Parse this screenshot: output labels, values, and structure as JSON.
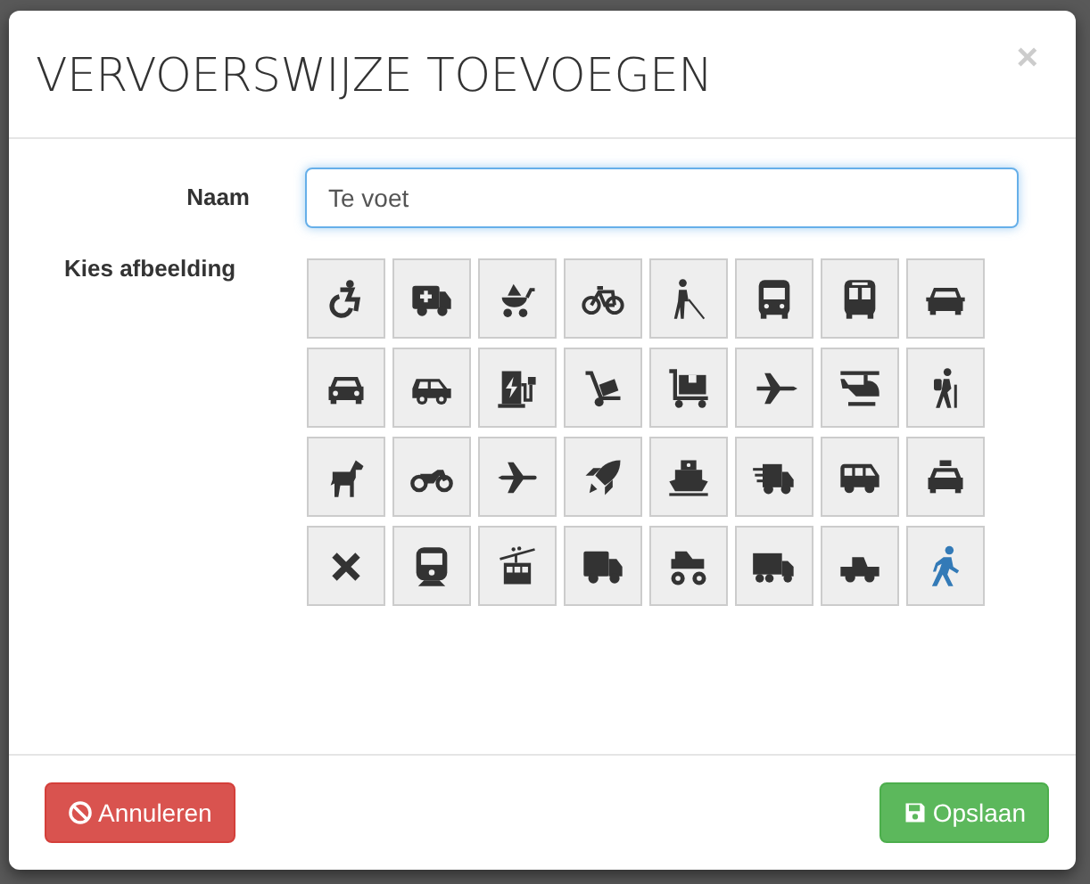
{
  "dialog": {
    "title": "VERVOERSWIJZE TOEVOEGEN",
    "close": "×"
  },
  "name_field": {
    "label": "Naam",
    "value": "Te voet"
  },
  "image_picker": {
    "label": "Kies afbeelding",
    "icons": [
      {
        "kind": "wheelchair",
        "selected": false
      },
      {
        "kind": "ambulance",
        "selected": false
      },
      {
        "kind": "stroller",
        "selected": false
      },
      {
        "kind": "bicycle",
        "selected": false
      },
      {
        "kind": "blind",
        "selected": false
      },
      {
        "kind": "bus",
        "selected": false
      },
      {
        "kind": "bus-alt",
        "selected": false
      },
      {
        "kind": "car-front",
        "selected": false
      },
      {
        "kind": "car-front-alt",
        "selected": false
      },
      {
        "kind": "car-side",
        "selected": false
      },
      {
        "kind": "charging",
        "selected": false
      },
      {
        "kind": "dolly",
        "selected": false
      },
      {
        "kind": "flatbed",
        "selected": false
      },
      {
        "kind": "jet",
        "selected": false
      },
      {
        "kind": "helicopter",
        "selected": false
      },
      {
        "kind": "hiking",
        "selected": false
      },
      {
        "kind": "horse",
        "selected": false
      },
      {
        "kind": "motorcycle",
        "selected": false
      },
      {
        "kind": "plane",
        "selected": false
      },
      {
        "kind": "rocket",
        "selected": false
      },
      {
        "kind": "ship",
        "selected": false
      },
      {
        "kind": "fast-van",
        "selected": false
      },
      {
        "kind": "van",
        "selected": false
      },
      {
        "kind": "taxi",
        "selected": false
      },
      {
        "kind": "cross",
        "selected": false
      },
      {
        "kind": "train",
        "selected": false
      },
      {
        "kind": "tram",
        "selected": false
      },
      {
        "kind": "truck",
        "selected": false
      },
      {
        "kind": "monster-truck",
        "selected": false
      },
      {
        "kind": "moving-truck",
        "selected": false
      },
      {
        "kind": "pickup",
        "selected": false
      },
      {
        "kind": "walking",
        "selected": true
      }
    ]
  },
  "buttons": [
    {
      "kind": "cancel",
      "label": "Annuleren"
    },
    {
      "kind": "save",
      "label": "Opslaan"
    }
  ]
}
